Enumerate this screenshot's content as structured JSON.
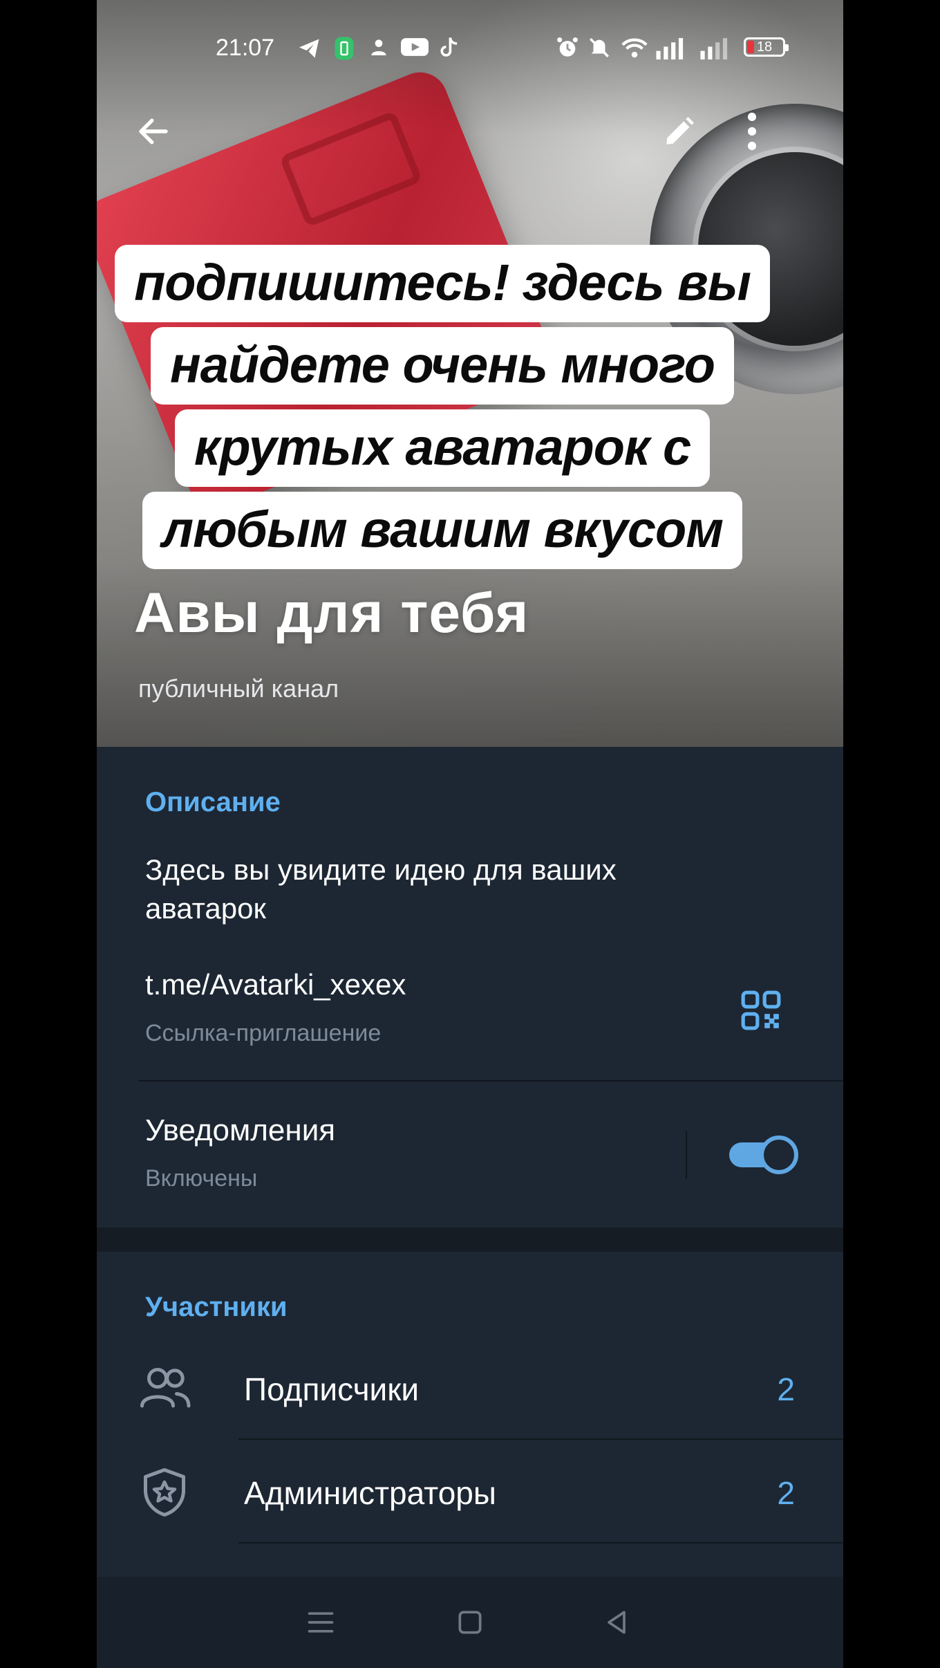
{
  "status_bar": {
    "time": "21:07",
    "battery": "18",
    "left_icons": [
      "telegram-icon",
      "battery-saver-icon",
      "person-icon",
      "youtube-icon",
      "tiktok-icon"
    ],
    "right_icons": [
      "alarm-icon",
      "mute-icon",
      "wifi-icon",
      "signal-icon",
      "signal-icon"
    ]
  },
  "caption": {
    "lines": [
      "подпишитесь! здесь вы",
      "найдете очень много",
      "крутых аватарок с",
      "любым вашим вкусом"
    ]
  },
  "channel": {
    "title": "Авы для тебя",
    "subtitle": "публичный канал"
  },
  "info": {
    "section_title": "Описание",
    "description": "Здесь вы увидите идею для ваших аватарок",
    "link": "t.me/Avatarki_xexex",
    "link_caption": "Ссылка-приглашение",
    "notifications_title": "Уведомления",
    "notifications_status": "Включены",
    "notifications_on": true
  },
  "members": {
    "section_title": "Участники",
    "rows": [
      {
        "label": "Подписчики",
        "count": "2",
        "icon": "people-icon"
      },
      {
        "label": "Администраторы",
        "count": "2",
        "icon": "shield-star-icon"
      }
    ]
  },
  "colors": {
    "background": "#1d2733",
    "accent": "#5fb0f0",
    "secondary_text": "#7d8b99",
    "toggle": "#5fa7e3"
  }
}
